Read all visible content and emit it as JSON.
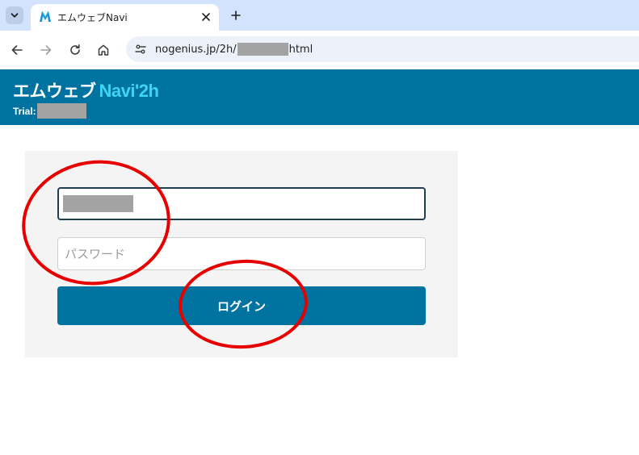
{
  "browser": {
    "tab_title": "エムウェブNavi",
    "url_prefix": "nogenius.jp/2h/",
    "url_suffix": "html"
  },
  "header": {
    "brand_main": "エムウェブ",
    "brand_navi": "Navi'2h",
    "trial_label": "Trial:"
  },
  "login": {
    "password_placeholder": "パスワード",
    "login_button": "ログイン"
  },
  "colors": {
    "header_bg": "#0073a0",
    "brand_accent": "#3fd4f2",
    "button_bg": "#0073a0",
    "annotation": "#e60000"
  }
}
